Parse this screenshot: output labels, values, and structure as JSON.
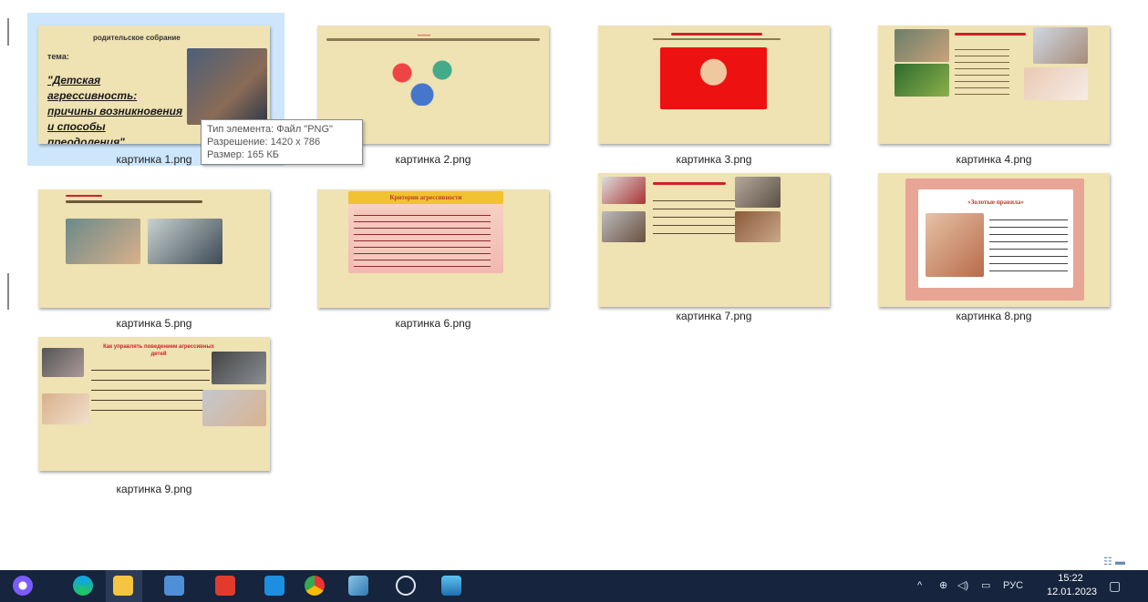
{
  "files": [
    {
      "name": "картинка 1.png",
      "selected": true
    },
    {
      "name": "картинка 2.png"
    },
    {
      "name": "картинка 3.png"
    },
    {
      "name": "картинка 4.png"
    },
    {
      "name": "картинка 5.png"
    },
    {
      "name": "картинка 6.png"
    },
    {
      "name": "картинка 7.png"
    },
    {
      "name": "картинка 8.png"
    },
    {
      "name": "картинка 9.png"
    }
  ],
  "slide1": {
    "header": "родительское собрание",
    "theme_label": "тема:",
    "title": "\"Детская агрессивность: причины возникновения и способы преодоления\"."
  },
  "slide6": {
    "title": "Критерии агрессивности"
  },
  "slide8": {
    "title": "«Золотые правила»"
  },
  "slide9": {
    "title": "Как управлять поведением агрессивных детей"
  },
  "tooltip": {
    "type": "Тип элемента: Файл \"PNG\"",
    "resolution": "Разрешение: 1420 x 786",
    "size": "Размер: 165 КБ"
  },
  "taskbar": {
    "lang": "РУС",
    "time": "15:22",
    "date": "12.01.2023"
  },
  "colors": {
    "slide_bg": "#efe2b3",
    "selection": "#cde6fb",
    "taskbar": "#16243d"
  }
}
